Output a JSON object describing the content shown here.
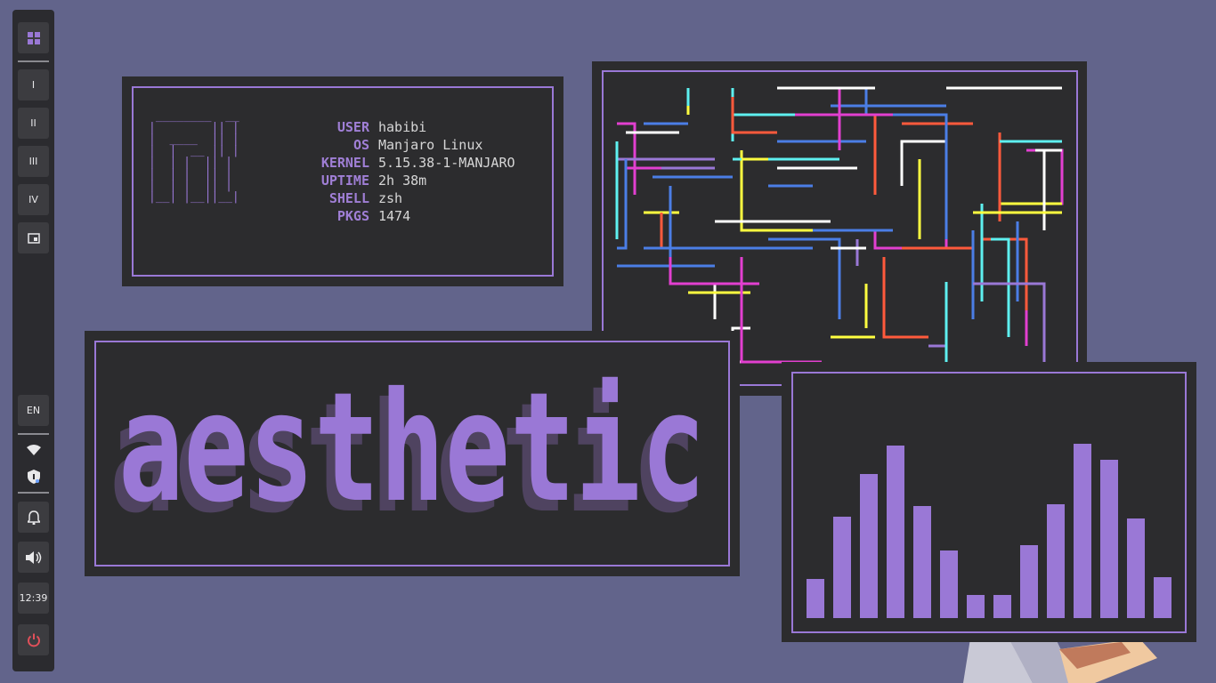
{
  "sidebar": {
    "launcher_icon": "apps-grid-icon",
    "workspaces": [
      {
        "label": "I"
      },
      {
        "label": "II"
      },
      {
        "label": "III"
      },
      {
        "label": "IV"
      }
    ],
    "layout_icon": "layout-window-icon",
    "keyboard_layout": "EN",
    "wifi_icon": "wifi-icon",
    "security_icon": "shield-icon",
    "notifications_icon": "bell-icon",
    "volume_icon": "volume-icon",
    "clock": "12:39",
    "power_icon": "power-icon",
    "power_color": "#e0505a"
  },
  "fetch": {
    "user_key": "USER",
    "user_val": "habibi",
    "os_key": "OS",
    "os_val": "Manjaro Linux",
    "kernel_key": "KERNEL",
    "kernel_val": "5.15.38-1-MANJARO",
    "uptime_key": "UPTIME",
    "uptime_val": "2h 38m",
    "shell_key": "SHELL",
    "shell_val": "zsh",
    "pkgs_key": "PKGS",
    "pkgs_val": "1474"
  },
  "banner": {
    "text": "aesthetic"
  },
  "visualizer": {
    "levels": [
      0.22,
      0.57,
      0.81,
      0.97,
      0.63,
      0.38,
      0.13,
      0.13,
      0.41,
      0.64,
      0.98,
      0.89,
      0.56,
      0.23
    ]
  },
  "colors": {
    "accent": "#9a78d6",
    "background": "#62648b",
    "window": "#2c2c2e",
    "pipe_colors": [
      "#e23fd0",
      "#ffffff",
      "#9a78d6",
      "#4b7ee6",
      "#5ef0f0",
      "#ffff40",
      "#ff5a3c"
    ]
  }
}
